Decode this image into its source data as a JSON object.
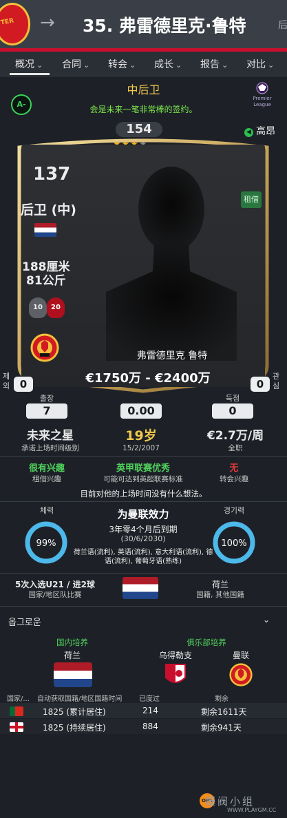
{
  "header": {
    "title": "35. 弗雷德里克·鲁特",
    "title_trunc": "后",
    "crest_text": "TER",
    "back_icon": "arrow-right-icon"
  },
  "tabs": [
    {
      "label": "概况"
    },
    {
      "label": "合同"
    },
    {
      "label": "转会"
    },
    {
      "label": "成长"
    },
    {
      "label": "报告"
    },
    {
      "label": "对比"
    }
  ],
  "profile": {
    "position_title": "中后卫",
    "grade": "A-",
    "recommendation": "会是未来一笔非常棒的签约。",
    "rating": "154",
    "stars": "★★★",
    "half_star": "★",
    "empty_star": "˙",
    "price_tag": "高昂",
    "price_icon": "arrow-left-icon"
  },
  "card": {
    "ca": "137",
    "position": "后卫 (中)",
    "height": "188厘米",
    "weight": "81公斤",
    "left_foot": "10",
    "right_foot": "20",
    "loan_badge": "租借",
    "name": "弗雷德里克 鲁特",
    "value": "€1750万 - €2400万"
  },
  "side": {
    "left_label": "제외",
    "left_value": "0",
    "right_label": "관심",
    "right_value": "0"
  },
  "stats": {
    "apps_label": "출장",
    "apps": "7",
    "avg_value": "0.00",
    "goals_label": "득점",
    "goals": "0",
    "status": "未来之星",
    "status_sub": "承诺上场时间级别",
    "age": "19岁",
    "dob": "15/2/2007",
    "wage": "€2.7万/周",
    "wage_sub": "全职"
  },
  "interest": {
    "loan_val": "很有兴趣",
    "loan_sub": "租借兴趣",
    "league_val": "英甲联赛优秀",
    "league_sub": "可能可达到英超联赛标准",
    "transfer_val": "无",
    "transfer_sub": "转会兴趣",
    "note": "目前对他的上场时间没有什么想法。"
  },
  "club": {
    "fitness_label": "체력",
    "fitness_pct": 99,
    "fitness_text": "99%",
    "sharp_label": "경기력",
    "sharp_pct": 100,
    "sharp_text": "100%",
    "playing_for": "为曼联效力",
    "contract": "3年零4个月后到期",
    "contract_date": "(30/6/2030)",
    "languages": "荷兰语(流利), 英语(流利), 意大利语(流利), 德语(流利), 葡萄牙语(熟练)",
    "intl": "5次入选U21 / 进2球",
    "intl_sub": "国家/地区队比赛",
    "nation": "荷兰",
    "nation_sub": "国籍, 其他国籍"
  },
  "background": {
    "section": "옵그로운",
    "home_grown_label": "国内培养",
    "home_nation": "荷兰",
    "club_grown_label": "俱乐部培养",
    "club1": "乌得勒支",
    "club2": "曼联",
    "cols": [
      "国家/...",
      "自动获取国籍/地区国籍时间",
      "已度过",
      "剩余"
    ],
    "rows": [
      {
        "flag": "portugal-flag-icon",
        "days": "1825 (累计居住)",
        "spent": "214",
        "remain": "剩余1611天"
      },
      {
        "flag": "england-flag-icon",
        "days": "1825 (持续居住)",
        "spent": "884",
        "remain": "剩余941天"
      }
    ]
  },
  "watermark": {
    "text": "爆阀小组",
    "url": "WWW.PLAYGM.CC",
    "logo": "OPS"
  },
  "colors": {
    "accent_gold": "#f2c94c",
    "green": "#50d15c",
    "red": "#c8102e",
    "ring_blue": "#4db8ea"
  }
}
